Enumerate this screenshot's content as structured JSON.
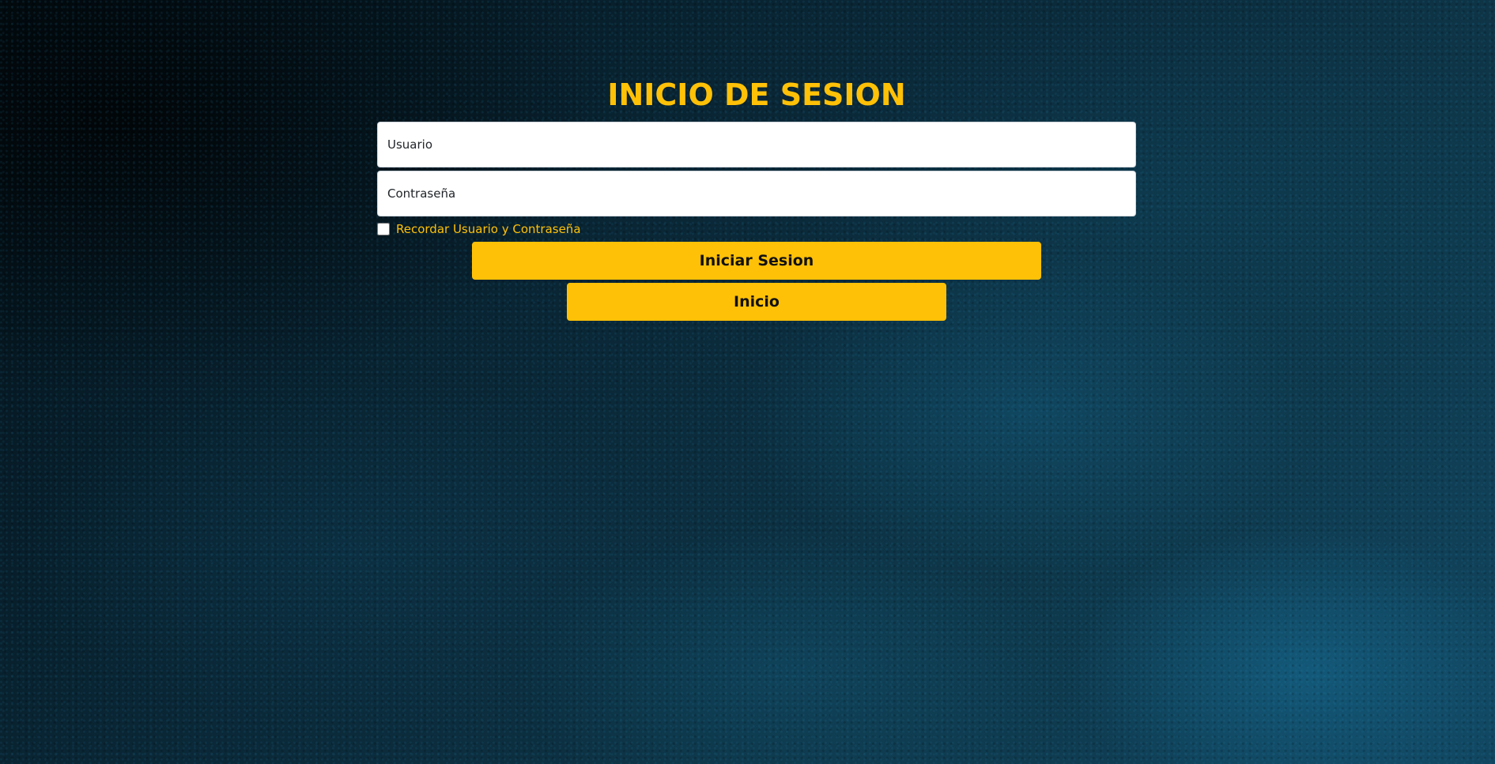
{
  "login": {
    "title": "INICIO DE SESION",
    "username_placeholder": "Usuario",
    "password_placeholder": "Contraseña",
    "remember_label": "Recordar Usuario y Contraseña",
    "remember_checked": false,
    "login_button": "Iniciar Sesion",
    "home_button": "Inicio"
  },
  "colors": {
    "accent": "#ffc107",
    "background": "#0a2736",
    "field_background": "#ffffff"
  }
}
